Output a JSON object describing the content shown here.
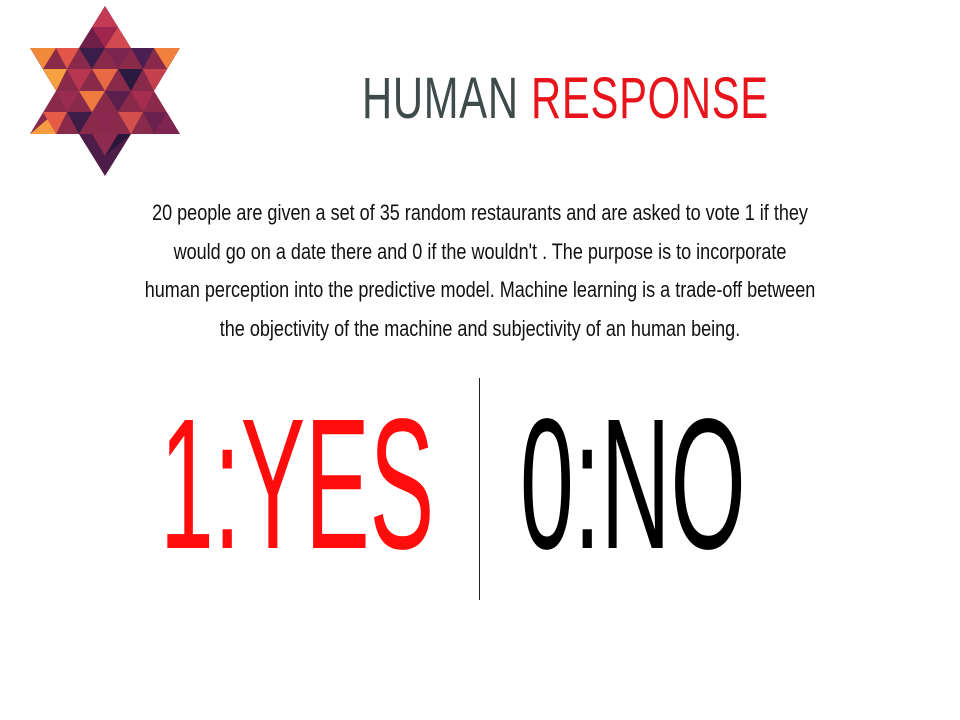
{
  "slide": {
    "title_part1": "HUMAN ",
    "title_part2": "RESPONSE",
    "body": "20 people are given a set of 35 random restaurants and are asked to vote 1 if they would go on a date there and 0 if the wouldn't . The purpose is to incorporate human perception into the predictive model. Machine learning is a trade-off between the objectivity of the machine and subjectivity of an human being.",
    "yes_label": "1:YES",
    "no_label": "0:NO"
  },
  "colors": {
    "title_dark": "#3f4a4a",
    "accent_red": "#e8141b",
    "yes_red": "#ff0d0d",
    "no_black": "#000000"
  },
  "icons": {
    "logo": "hexagram-triangle-mosaic-icon"
  }
}
